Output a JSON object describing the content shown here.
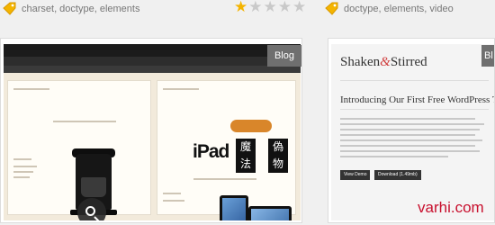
{
  "left_item": {
    "tags": "charset, doctype, elements",
    "rating": {
      "filled": 1,
      "total": 5
    },
    "badge": "Blog"
  },
  "right_item": {
    "tags": "doctype, elements, video",
    "badge": "Bl",
    "brand_left": "Shaken",
    "brand_amp": "&",
    "brand_right": "Stirred",
    "heading": "Introducing Our First Free WordPress The",
    "btn1": "View Demo",
    "btn2": "Download (1.49mb)",
    "watermark": "varhi.com"
  },
  "colors": {
    "tag": "#f4b400",
    "star": "#f4b400",
    "badge": "#6f6f6f",
    "watermark": "#c8102e"
  }
}
